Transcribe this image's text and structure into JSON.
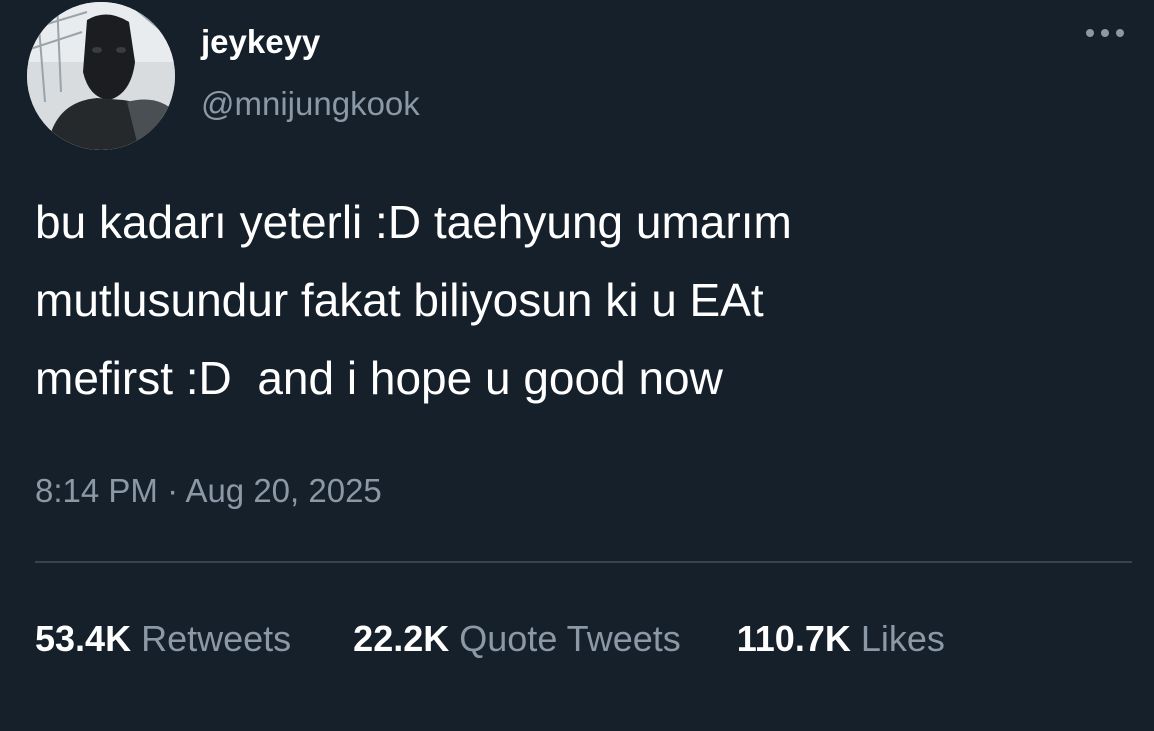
{
  "tweet": {
    "display_name": "jeykeyy",
    "handle": "@mnijungkook",
    "text": "bu kadarı yeterli :D taehyung umarım\nmutlusundur fakat biliyosun ki u EAt\nmefirst :D  and i hope u good now",
    "time": "8:14 PM",
    "separator": "·",
    "date": "Aug 20, 2025",
    "more_icon": "more-horizontal-icon"
  },
  "stats": {
    "retweets_count": "53.4K",
    "retweets_label": "Retweets",
    "quotes_count": "22.2K",
    "quotes_label": "Quote Tweets",
    "likes_count": "110.7K",
    "likes_label": "Likes"
  },
  "colors": {
    "background": "#15202b",
    "primary_text": "#ffffff",
    "secondary_text": "#8b98a5",
    "divider": "#38444d"
  }
}
